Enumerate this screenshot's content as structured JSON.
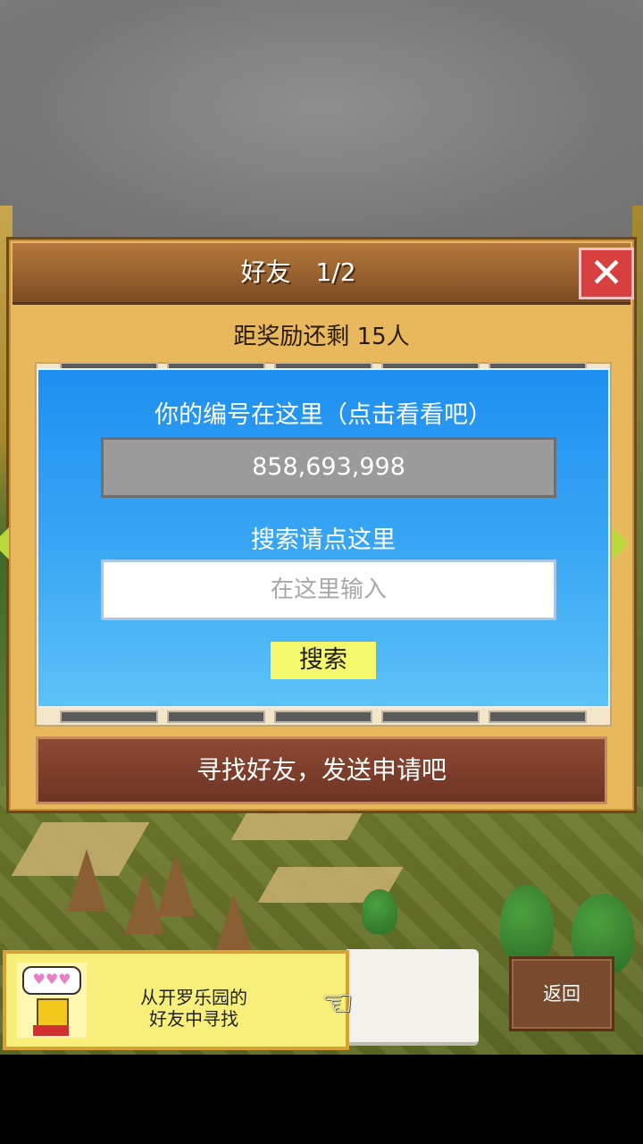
{
  "dialog": {
    "title": "好友　1/2",
    "close_label": "✕",
    "reward_text": "距奖励还剩 15人",
    "id_label": "你的编号在这里（点击看看吧）",
    "id_value": "858,693,998",
    "search_label": "搜索请点这里",
    "search_placeholder": "在这里输入",
    "search_button": "搜索",
    "find_friend_button": "寻找好友，发送申请吧"
  },
  "bottom": {
    "tip_bubble": "♥♥♥",
    "tip_line1": "从开罗乐园的",
    "tip_line2": "好友中寻找",
    "pointer": "☜",
    "back_button": "返回"
  },
  "colors": {
    "panel": "#e8b85c",
    "title_bar": "#9a6330",
    "close_button": "#d84040",
    "blue_box": "#3aa7f4",
    "search_button": "#f4f86a",
    "find_friend_button": "#7a3c2a",
    "tip_box": "#f7ef7a",
    "back_button": "#7a4a2e"
  },
  "icons": {
    "close": "close-icon",
    "left_arrow": "arrow-left-icon",
    "right_arrow": "arrow-right-icon",
    "pointer": "pointing-hand-icon"
  }
}
